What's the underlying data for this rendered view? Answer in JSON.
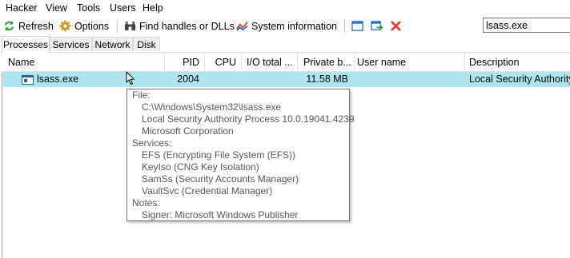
{
  "menu": [
    "Hacker",
    "View",
    "Tools",
    "Users",
    "Help"
  ],
  "toolbar": {
    "refresh": "Refresh",
    "options": "Options",
    "find_handles": "Find handles or DLLs",
    "system_info": "System information"
  },
  "search": {
    "value": "lsass.exe"
  },
  "tabs": [
    "Processes",
    "Services",
    "Network",
    "Disk"
  ],
  "columns": [
    "Name",
    "PID",
    "CPU",
    "I/O total ...",
    "Private b...",
    "User name",
    "Description"
  ],
  "process": {
    "name": "lsass.exe",
    "pid": "2004",
    "private_bytes": "11.58 MB",
    "description": "Local Security Authority"
  },
  "tooltip": {
    "file_header": "File:",
    "file_lines": [
      "C:\\Windows\\System32\\lsass.exe",
      "Local Security Authority Process 10.0.19041.4239",
      "Microsoft Corporation"
    ],
    "services_header": "Services:",
    "services": [
      "EFS (Encrypting File System (EFS))",
      "KeyIso (CNG Key Isolation)",
      "SamSs (Security Accounts Manager)",
      "VaultSvc (Credential Manager)"
    ],
    "notes_header": "Notes:",
    "notes": [
      "Signer: Microsoft Windows Publisher"
    ]
  },
  "colors": {
    "selection": "#aee6f0",
    "close_red": "#e23a2e"
  },
  "icons": [
    "refresh-icon",
    "gear-icon",
    "binoculars-icon",
    "chart-icon",
    "window-icon",
    "go-to-icon",
    "close-icon",
    "process-icon",
    "mouse-cursor-icon"
  ]
}
